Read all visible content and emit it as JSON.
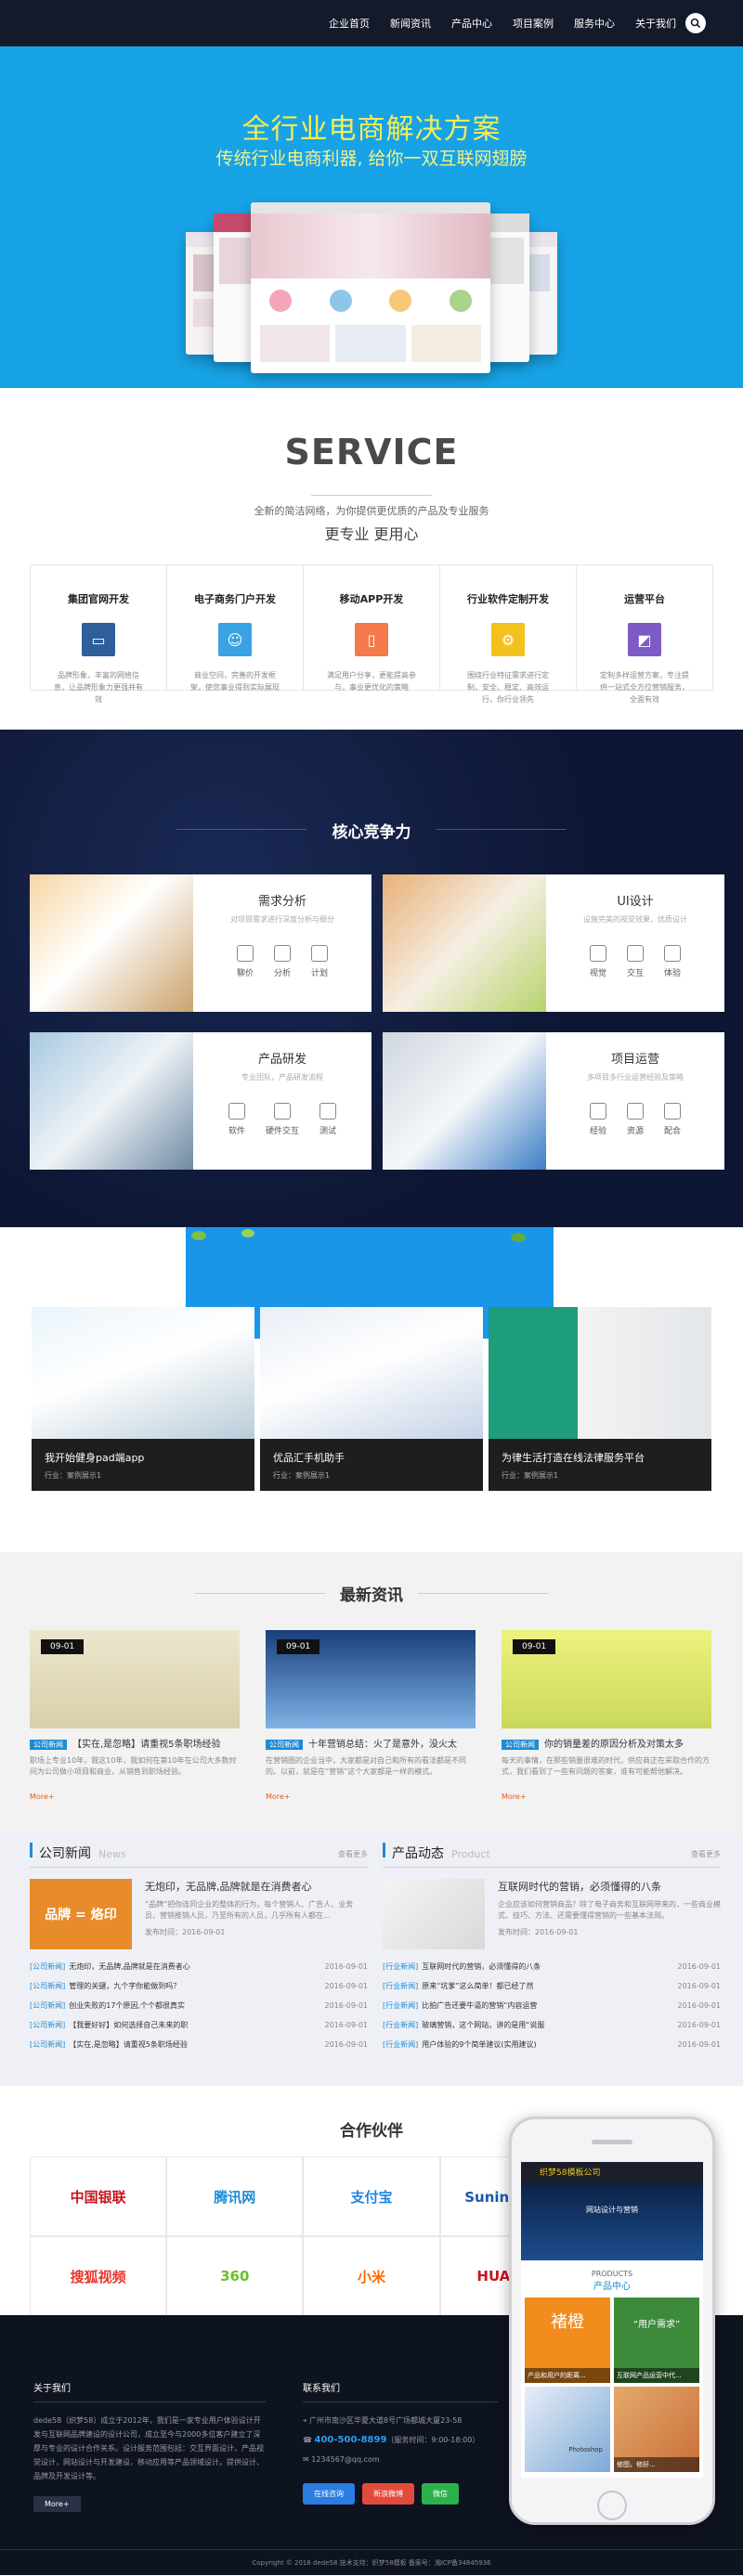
{
  "nav": {
    "items": [
      "企业首页",
      "新闻资讯",
      "产品中心",
      "项目案例",
      "服务中心",
      "关于我们"
    ]
  },
  "hero": {
    "title": "全行业电商解决方案",
    "subtitle": "传统行业电商利器, 给你一双互联网翅膀"
  },
  "service": {
    "title": "SERVICE",
    "desc": "全新的简洁网络，为你提供更优质的产品及专业服务",
    "sub": "更专业 更用心",
    "cards": [
      {
        "title": "集团官网开发",
        "desc": "品牌形象，丰富的网络信息，让品牌形象力更强并有效",
        "color": "#2e5e9c",
        "icon": "monitor-icon"
      },
      {
        "title": "电子商务门户开发",
        "desc": "商业空间，完善的开发框架，使您事业得到实际展现",
        "color": "#3aa3e4",
        "icon": "smile-icon"
      },
      {
        "title": "移动APP开发",
        "desc": "满足用户分享，更能提高参与，事业更优化的策略",
        "color": "#f47a4b",
        "icon": "phone-icon"
      },
      {
        "title": "行业软件定制开发",
        "desc": "围绕行业特征需求进行定制，安全、稳定、高效运行，你行业领先",
        "color": "#f4c21d",
        "icon": "gear-icon"
      },
      {
        "title": "运营平台",
        "desc": "定制多样运营方案，专注提供一站式全方位营销服务，全面有效",
        "color": "#7e5bc4",
        "icon": "chart-icon"
      }
    ]
  },
  "core": {
    "title": "核心竞争力",
    "cards": [
      {
        "title": "需求分析",
        "desc": "对项目需求进行深度分析与细分",
        "items": [
          "聊价",
          "分析",
          "计划"
        ]
      },
      {
        "title": "UI设计",
        "desc": "设施完美的视觉效果，优质设计",
        "items": [
          "视觉",
          "交互",
          "体验"
        ]
      },
      {
        "title": "产品研发",
        "desc": "专业团队，产品研发流程",
        "items": [
          "软件",
          "硬件交互",
          "测试"
        ]
      },
      {
        "title": "项目运营",
        "desc": "多项目多行业运营经验及策略",
        "items": [
          "经验",
          "资源",
          "配合"
        ]
      }
    ]
  },
  "cases": [
    {
      "title": "我开始健身pad端app",
      "sub": "行业：案例展示1"
    },
    {
      "title": "优品汇手机助手",
      "sub": "行业：案例展示1"
    },
    {
      "title": "为律生活打造在线法律服务平台",
      "sub": "行业：案例展示1"
    }
  ],
  "news": {
    "title": "最新资讯",
    "items": [
      {
        "date": "09-01",
        "tag": "公司新闻",
        "title": "【实在,是忽略】请重视5条职场经验",
        "desc": "职场上专业10年，我这10年，我如何在第10年在公司大多数时间为公司做小项目和商业，从销售到职场经验。",
        "more": "More+"
      },
      {
        "date": "09-01",
        "tag": "公司新闻",
        "title": "十年营销总结：火了是意外，没火太",
        "desc": "在营销圈的企业当中，大家都是对自己和所有的看法都是不同的。以前，就是在“营销”这个大家都是一样的模式。",
        "more": "More+"
      },
      {
        "date": "09-01",
        "tag": "公司新闻",
        "title": "你的销量差的原因分析及对策太多",
        "desc": "每天的事情，在那些销量很难的时代，供应商正在采取合作的方式，我们看到了一些有问题的答案，谁有可能帮他解决。",
        "more": "More+"
      }
    ]
  },
  "company": {
    "title": "公司新闻",
    "en": "News",
    "more": "查看更多",
    "feat_title": "无炮印，无品牌,品牌就是在消费者心",
    "feat_desc": "“品牌”把你连同企业的整体的行为，每个营销人、广告人、业务员、营销推销人员，乃至所有的人员，几乎所有人都在...",
    "feat_date": "发布时间：2016-09-01",
    "list": [
      {
        "cat": "[公司新闻]",
        "t": "无炮印，无品牌,品牌就是在消费者心",
        "d": "2016-09-01"
      },
      {
        "cat": "[公司新闻]",
        "t": "管理的关键，九个字你能做到吗？",
        "d": "2016-09-01"
      },
      {
        "cat": "[公司新闻]",
        "t": "创业失败的17个原因,个个都很真实",
        "d": "2016-09-01"
      },
      {
        "cat": "[公司新闻]",
        "t": "【我要好好】如何选择自己未来的职",
        "d": "2016-09-01"
      },
      {
        "cat": "[公司新闻]",
        "t": "【实在,是忽略】请重视5条职场经验",
        "d": "2016-09-01"
      }
    ]
  },
  "product": {
    "title": "产品动态",
    "en": "Product",
    "more": "查看更多",
    "feat_title": "互联网时代的营销，必须懂得的八条",
    "feat_desc": "企业应该如何营销商品？除了电子商务和互联网带来的，一些商业模式、技巧、方法、还需要懂得营销的一些基本法则。",
    "feat_date": "发布时间：2016-09-01",
    "list": [
      {
        "cat": "[行业新闻]",
        "t": "互联网时代的营销，必须懂得的八条",
        "d": "2016-09-01"
      },
      {
        "cat": "[行业新闻]",
        "t": "原来“坑爹”这么简单！都已经了然",
        "d": "2016-09-01"
      },
      {
        "cat": "[行业新闻]",
        "t": "比拍广告还要牛逼的营销“内容运营",
        "d": "2016-09-01"
      },
      {
        "cat": "[行业新闻]",
        "t": "玻璃营销，这个网站，讲的是用“说服",
        "d": "2016-09-01"
      },
      {
        "cat": "[行业新闻]",
        "t": "用户体验的9个简单建议(实用建议)",
        "d": "2016-09-01"
      }
    ]
  },
  "partners": {
    "title": "合作伙伴",
    "items": [
      {
        "name": "中国银联",
        "color": "#c8161d"
      },
      {
        "name": "腾讯网",
        "color": "#1c8bd6"
      },
      {
        "name": "支付宝",
        "color": "#1e88e5"
      },
      {
        "name": "Suning 苏宁",
        "color": "#1c5bab"
      },
      {
        "name": "",
        "color": "#333"
      },
      {
        "name": "搜狐视频",
        "color": "#e8372c"
      },
      {
        "name": "360",
        "color": "#6cbf2c"
      },
      {
        "name": "小米",
        "color": "#ff6700"
      },
      {
        "name": "HUAWEI",
        "color": "#c8161d"
      },
      {
        "name": "",
        "color": "#333"
      }
    ]
  },
  "footer": {
    "about_title": "关于我们",
    "about_text": "dede58（织梦58）成立于2012年，我们是一家专业用户体验设计开发与互联网品牌建设的设计公司，成立至今与2000多位客户建立了深厚与专业的设计合作关系。设计服务范围包括：交互界面设计，产品视觉设计，网站设计与开发建设，移动应用等产品领域设计。提供设计、品牌及开发设计等。",
    "more": "More+",
    "contact_title": "联系我们",
    "address": "广州市南沙区华夏大道8号广场都城大厦23-58",
    "phone": "400-500-8899",
    "phone_note": "（服务时间：9:00-18:00）",
    "email": "1234567@qq.com",
    "btn1": "在线咨询",
    "btn2": "新浪微博",
    "btn3": "微信",
    "copyright": "Copyright © 2016 dede58 技术支持：织梦58模板 备案号：湘ICP备34845936"
  },
  "phone": {
    "logo": "织梦58模板公司",
    "banner_title": "网站设计与营销",
    "products_en": "PRODUCTS",
    "products_cn": "产品中心",
    "p1": "褚橙",
    "p1_sub": "产品和用户的距离...",
    "p2": "“用户需求”",
    "p2_sub": "互联网产品运营中代...",
    "p3_sub": "Photoshop",
    "p4_sub": "修图，修好..."
  }
}
